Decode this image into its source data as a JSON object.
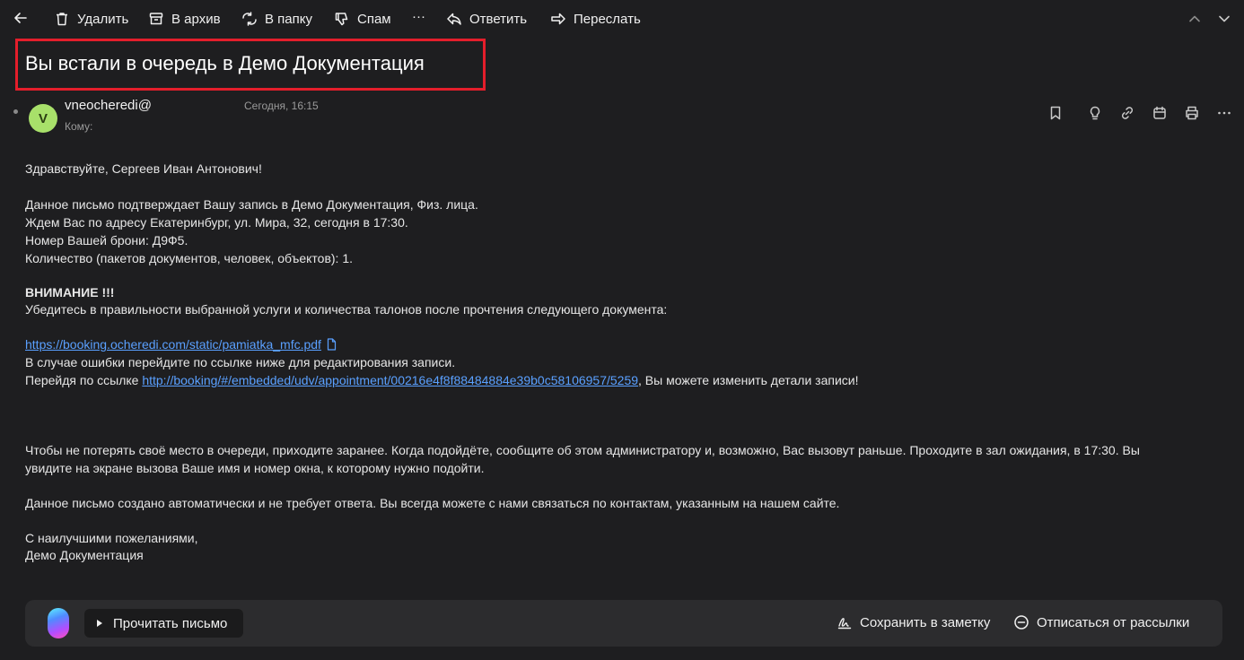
{
  "toolbar": {
    "delete_label": "Удалить",
    "archive_label": "В архив",
    "folder_label": "В папку",
    "spam_label": "Спам",
    "more_label": "···",
    "reply_label": "Ответить",
    "forward_label": "Переслать"
  },
  "email": {
    "subject": "Вы встали в очередь в Демо Документация",
    "avatar_letter": "V",
    "sender": "vneocheredi@",
    "date": "Сегодня, 16:15",
    "to_label": "Кому:",
    "body": {
      "greeting": "Здравствуйте, Сергеев Иван Антонович!",
      "line1": "Данное письмо подтверждает Вашу запись в Демо Документация, Физ. лица.",
      "line2": "Ждем Вас по адресу Екатеринбург, ул. Мира, 32, сегодня в 17:30.",
      "line3": "Номер Вашей брони: Д9Ф5.",
      "line4": "Количество (пакетов документов, человек, объектов): 1.",
      "attention": "ВНИМАНИЕ !!!",
      "line5": "Убедитесь в правильности выбранной услуги и количества талонов после прочтения следующего документа:",
      "doc_link": "https://booking.ocheredi.com/static/pamiatka_mfc.pdf",
      "line6": "В случае ошибки перейдите по ссылке ниже для редактирования записи.",
      "line7_prefix": "Перейдя по ссылке ",
      "edit_link": "http://booking/#/embedded/udv/appointment/00216e4f8f88484884e39b0c58106957/5259",
      "line7_suffix": ", Вы можете изменить детали записи!",
      "para1_line1": "Чтобы не потерять своё место в очереди, приходите заранее. Когда подойдёте, сообщите об этом администратору и, возможно, Вас вызовут раньше. Проходите в зал ожидания, в 17:30. Вы",
      "para1_line2": "увидите на экране вызова Ваше имя и номер окна, к которому нужно подойти.",
      "para2": "Данное письмо создано автоматически и не требует ответа. Вы всегда можете с нами связаться по контактам, указанным на нашем сайте.",
      "sign1": "С наилучшими пожеланиями,",
      "sign2": "Демо Документация"
    }
  },
  "bottom_bar": {
    "read_label": "Прочитать письмо",
    "save_note_label": "Сохранить в заметку",
    "unsubscribe_label": "Отписаться от рассылки"
  },
  "colors": {
    "background": "#1e1e20",
    "link": "#5aa0ff",
    "highlight_border": "#e41e2b",
    "avatar": "#a8e06a"
  }
}
